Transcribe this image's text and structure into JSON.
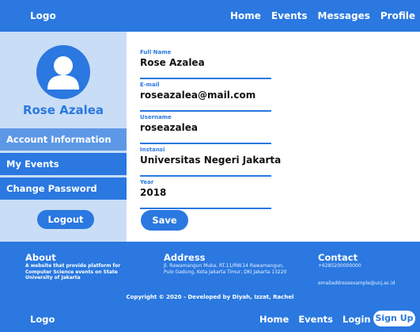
{
  "topnav": {
    "logo": "Logo",
    "links": [
      "Home",
      "Events",
      "Messages",
      "Profile"
    ]
  },
  "sidebar": {
    "avatar_icon": "user-avatar-icon",
    "name": "Rose Azalea",
    "items": [
      {
        "label": "Account Information",
        "active": true
      },
      {
        "label": "My Events",
        "active": false
      },
      {
        "label": "Change Password",
        "active": false
      }
    ],
    "logout_label": "Logout"
  },
  "form": {
    "fields": [
      {
        "label": "Full Name",
        "value": "Rose Azalea"
      },
      {
        "label": "E-mail",
        "value": "roseazalea@mail.com"
      },
      {
        "label": "Username",
        "value": "roseazalea"
      },
      {
        "label": "Instansi",
        "value": "Universitas Negeri Jakarta"
      },
      {
        "label": "Year",
        "value": "2018"
      }
    ],
    "save_label": "Save"
  },
  "footer": {
    "about_title": "About",
    "about_text": "A website that provide platform for Computer Science events on State University of Jakarta",
    "address_title": "Address",
    "address_text": "Jl. Rawamangun Muka, RT.11/RW.14 Rawamangun, Pulo Gadung, Kota Jakarta Timur, DKI Jakarta 13220",
    "contact_title": "Contact",
    "contact_phone": "+6285200000000",
    "contact_email": "emailaddressexample@unj.ac.id",
    "copyright": "Copyright © 2020 - Developed by Diyah, Izzat, Rachel"
  },
  "bottomnav": {
    "logo": "Logo",
    "links": [
      "Home",
      "Events",
      "Login"
    ],
    "signup_label": "Sign Up"
  },
  "colors": {
    "primary": "#2a78e0",
    "sidebar_bg": "#c9ddf6",
    "active_item": "#5d98e6"
  }
}
